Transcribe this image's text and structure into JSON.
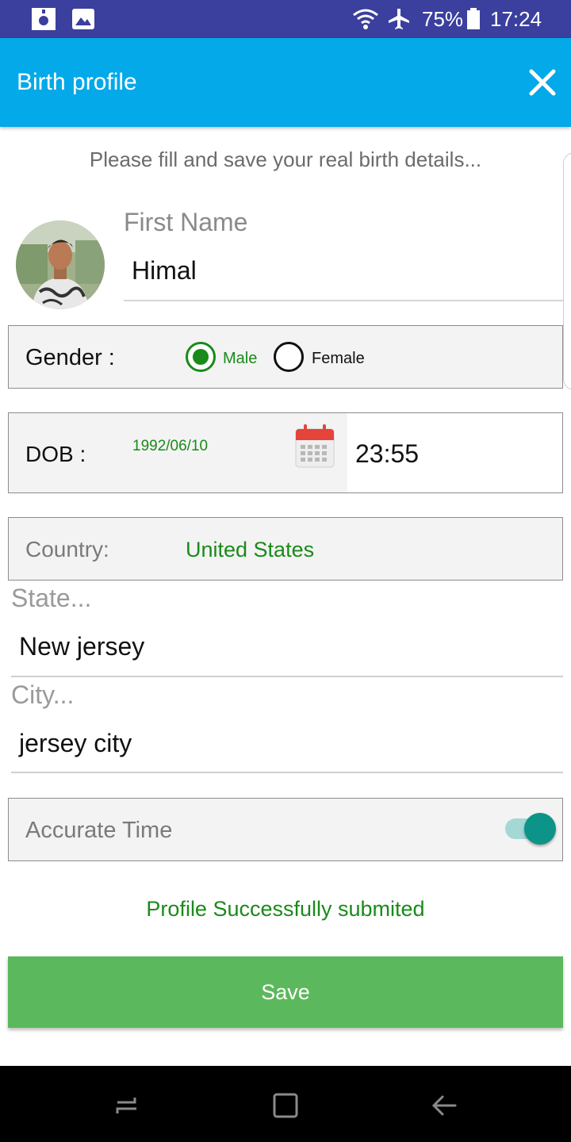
{
  "status_bar": {
    "battery": "75%",
    "time": "17:24",
    "icons": [
      "notification-icon",
      "gallery-icon",
      "wifi-icon",
      "airplane-icon",
      "battery-icon"
    ]
  },
  "app_bar": {
    "title": "Birth profile",
    "close_icon": "close-icon"
  },
  "form": {
    "hint": "Please fill and save your real birth details...",
    "first_name": {
      "label": "First Name",
      "value": "Himal"
    },
    "gender": {
      "label": "Gender :",
      "options": [
        {
          "label": "Male",
          "selected": true
        },
        {
          "label": "Female",
          "selected": false
        }
      ]
    },
    "dob": {
      "label": "DOB :",
      "date": "1992/06/10",
      "time": "23:55"
    },
    "country": {
      "label": "Country:",
      "value": "United States"
    },
    "state": {
      "label": "State...",
      "value": "New jersey"
    },
    "city": {
      "label": "City...",
      "value": "jersey city"
    },
    "accurate_time": {
      "label": "Accurate Time",
      "enabled": true
    },
    "status_message": "Profile Successfully submited",
    "save_label": "Save"
  },
  "colors": {
    "status_bar": "#3b3f9e",
    "app_bar": "#03a9e8",
    "accent_green": "#1a8a1a",
    "save_button": "#5cb85c",
    "toggle": "#0c9488"
  },
  "nav_bar": {
    "icons": [
      "recents-icon",
      "home-icon",
      "back-icon"
    ]
  }
}
